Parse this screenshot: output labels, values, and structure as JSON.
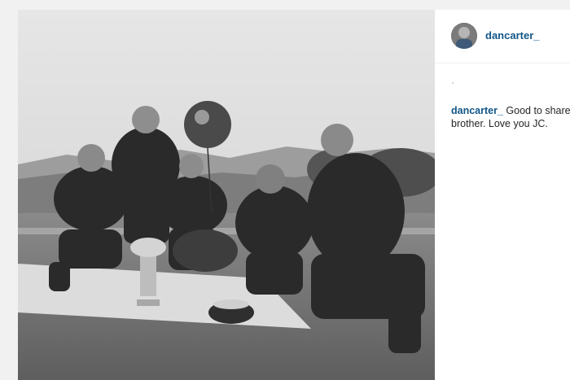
{
  "post": {
    "username": "dancarter_",
    "caption": {
      "username": "dancarter_",
      "text": " Good to share the brother. Love you JC."
    }
  },
  "colors": {
    "link": "#125688",
    "text": "#262626",
    "background": "#f1f1f1"
  },
  "icons": {
    "avatar": "profile-photo"
  }
}
